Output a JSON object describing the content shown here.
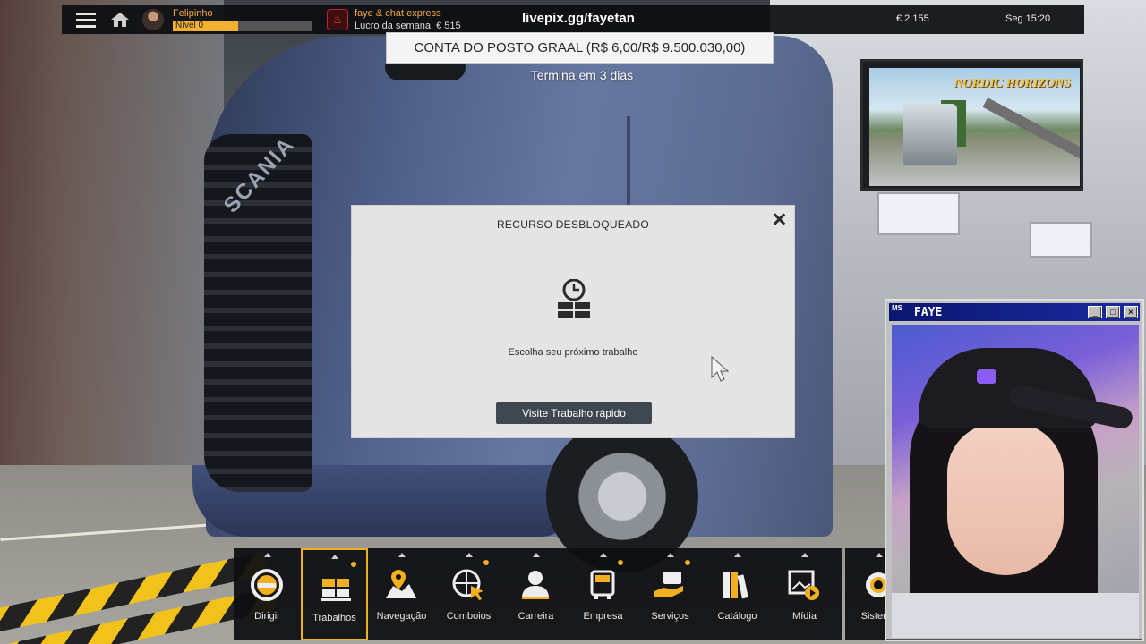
{
  "topbar": {
    "player_name": "Felipinho",
    "level_label": "Nível 0",
    "level_progress": 0.47,
    "company_name": "faye & chat express",
    "weekly_profit": "Lucro da semana: € 515",
    "stream_url": "livepix.gg/fayetan",
    "money": "€ 2.155",
    "day_time": "Seg 15:20"
  },
  "event": {
    "title": "CONTA DO POSTO GRAAL (R$ 6,00/R$ 9.500.030,00)",
    "subtitle": "Termina em 3 dias"
  },
  "promo": {
    "title": "NORDIC HORIZONS"
  },
  "scene": {
    "brand": "SCANIA"
  },
  "modal": {
    "title": "RECURSO DESBLOQUEADO",
    "message": "Escolha seu próximo trabalho",
    "button_label": "Visite Trabalho rápido",
    "icon": "jobs-clock-icon"
  },
  "dock": {
    "items": [
      {
        "label": "Dirigir",
        "icon": "steering-wheel-icon",
        "active": false,
        "notify": false
      },
      {
        "label": "Trabalhos",
        "icon": "cargo-icon",
        "active": true,
        "notify": true
      },
      {
        "label": "Navegação",
        "icon": "map-pin-icon",
        "active": false,
        "notify": false
      },
      {
        "label": "Comboios",
        "icon": "globe-cursor-icon",
        "active": false,
        "notify": true
      },
      {
        "label": "Carreira",
        "icon": "person-icon",
        "active": false,
        "notify": false
      },
      {
        "label": "Empresa",
        "icon": "truck-front-icon",
        "active": false,
        "notify": true
      },
      {
        "label": "Serviços",
        "icon": "service-icon",
        "active": false,
        "notify": true
      },
      {
        "label": "Catálogo",
        "icon": "books-icon",
        "active": false,
        "notify": false
      },
      {
        "label": "Mídia",
        "icon": "media-icon",
        "active": false,
        "notify": false
      },
      {
        "label": "Sistema",
        "icon": "gear-icon",
        "active": false,
        "notify": false
      }
    ]
  },
  "webcam": {
    "title": "FAYE",
    "logo_text": "MS"
  },
  "colors": {
    "accent": "#f2b01e",
    "player_name": "#f2a93b",
    "modal_bg": "#e4e4e4",
    "button_bg": "#3e4650",
    "window_title": "#0b1670"
  }
}
